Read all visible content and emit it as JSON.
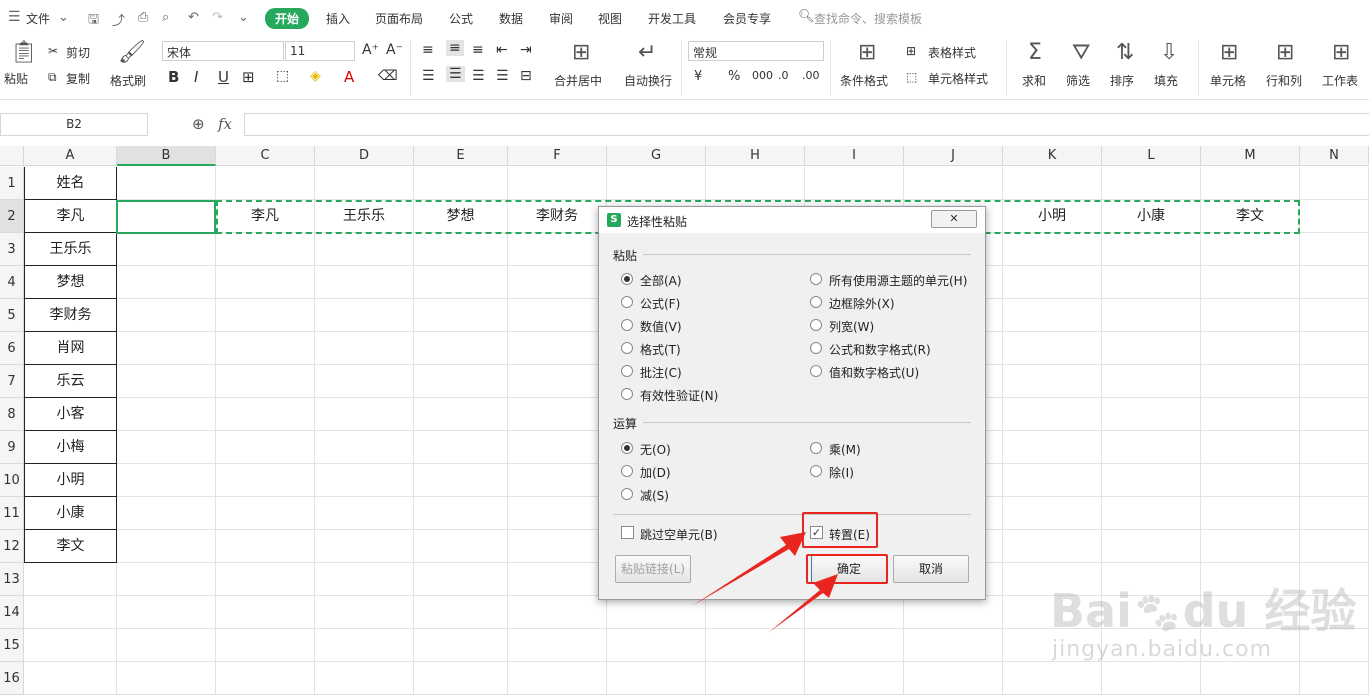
{
  "menu": {
    "file": "文件",
    "tabs": [
      "开始",
      "插入",
      "页面布局",
      "公式",
      "数据",
      "审阅",
      "视图",
      "开发工具",
      "会员专享"
    ],
    "search": "查找命令、搜索模板"
  },
  "ribbon": {
    "paste": "粘贴",
    "cut": "剪切",
    "copy": "复制",
    "format_painter": "格式刷",
    "font_name": "宋体",
    "font_size": "11",
    "merge": "合并居中",
    "wrap": "自动换行",
    "number_format": "常规",
    "cond_format": "条件格式",
    "table_style": "表格样式",
    "cell_style": "单元格样式",
    "sum": "求和",
    "filter": "筛选",
    "sort": "排序",
    "fill": "填充",
    "cell": "单元格",
    "rowcol": "行和列",
    "sheet": "工作表"
  },
  "formula_bar": {
    "namebox": "B2",
    "fx": "fx",
    "value": ""
  },
  "columns": [
    "A",
    "B",
    "C",
    "D",
    "E",
    "F",
    "G",
    "H",
    "I",
    "J",
    "K",
    "L",
    "M",
    "N"
  ],
  "rows": [
    "1",
    "2",
    "3",
    "4",
    "5",
    "6",
    "7",
    "8",
    "9",
    "10",
    "11",
    "12",
    "13",
    "14",
    "15",
    "16"
  ],
  "col_a": [
    "姓名",
    "李凡",
    "王乐乐",
    "梦想",
    "李财务",
    "肖网",
    "乐云",
    "小客",
    "小梅",
    "小明",
    "小康",
    "李文"
  ],
  "row2": {
    "C": "李凡",
    "D": "王乐乐",
    "E": "梦想",
    "F": "李财务",
    "K": "小明",
    "L": "小康",
    "M": "李文"
  },
  "dialog": {
    "title": "选择性粘贴",
    "paste_group": "粘贴",
    "paste_left": [
      "全部(A)",
      "公式(F)",
      "数值(V)",
      "格式(T)",
      "批注(C)",
      "有效性验证(N)"
    ],
    "paste_right": [
      "所有使用源主题的单元(H)",
      "边框除外(X)",
      "列宽(W)",
      "公式和数字格式(R)",
      "值和数字格式(U)"
    ],
    "op_group": "运算",
    "op_left": [
      "无(O)",
      "加(D)",
      "减(S)"
    ],
    "op_right": [
      "乘(M)",
      "除(I)"
    ],
    "skip_blanks": "跳过空单元(B)",
    "transpose": "转置(E)",
    "paste_link": "粘贴链接(L)",
    "ok": "确定",
    "cancel": "取消"
  },
  "watermark": {
    "brand": "Bai",
    "brand2": "du",
    "cn": "经验",
    "url": "jingyan.baidu.com"
  },
  "colors": {
    "accent": "#26a95c",
    "annotation": "#e8261f"
  }
}
